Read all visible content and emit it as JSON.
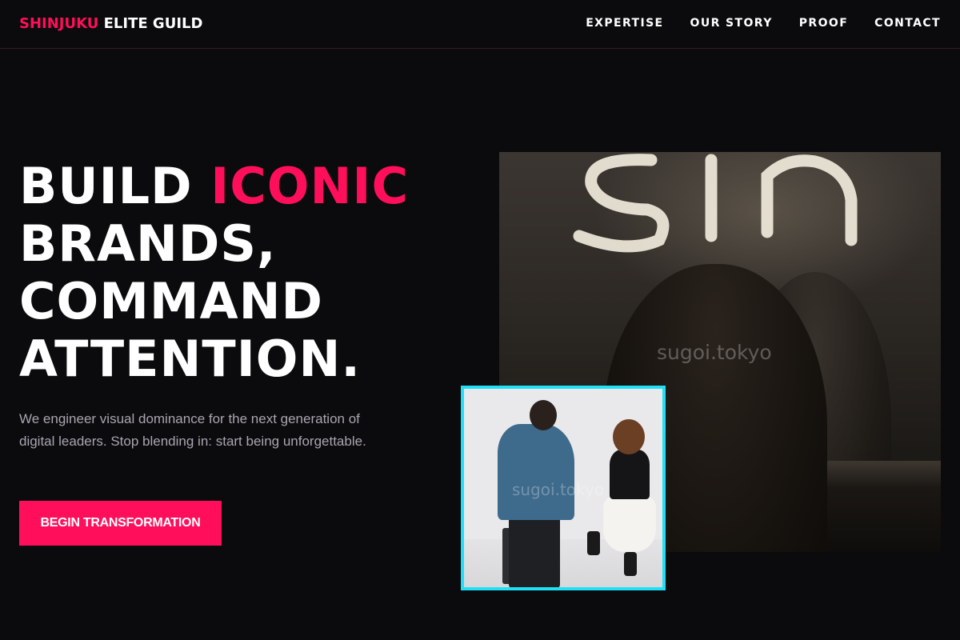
{
  "brand": {
    "accent_text": "SHINJUKU",
    "rest_text": " ELITE GUILD"
  },
  "nav": {
    "items": [
      {
        "label": "EXPERTISE"
      },
      {
        "label": "OUR STORY"
      },
      {
        "label": "PROOF"
      },
      {
        "label": "CONTACT"
      }
    ]
  },
  "hero": {
    "title_line1_a": "BUILD ",
    "title_line1_b": "ICONIC",
    "title_line2": "BRANDS,",
    "title_line3": "COMMAND",
    "title_line4": "ATTENTION.",
    "subtitle": "We engineer visual dominance for the next generation of digital leaders. Stop blending in: start being unforgettable.",
    "cta_label": "BEGIN TRANSFORMATION"
  },
  "images": {
    "main_watermark": "sugoi.tokyo",
    "inset_watermark": "sugoi.tokyo"
  },
  "colors": {
    "background": "#0b0a0c",
    "accent": "#ff0f5b",
    "inset_border": "#1fe0f7",
    "subtitle": "#a9a6b0"
  }
}
